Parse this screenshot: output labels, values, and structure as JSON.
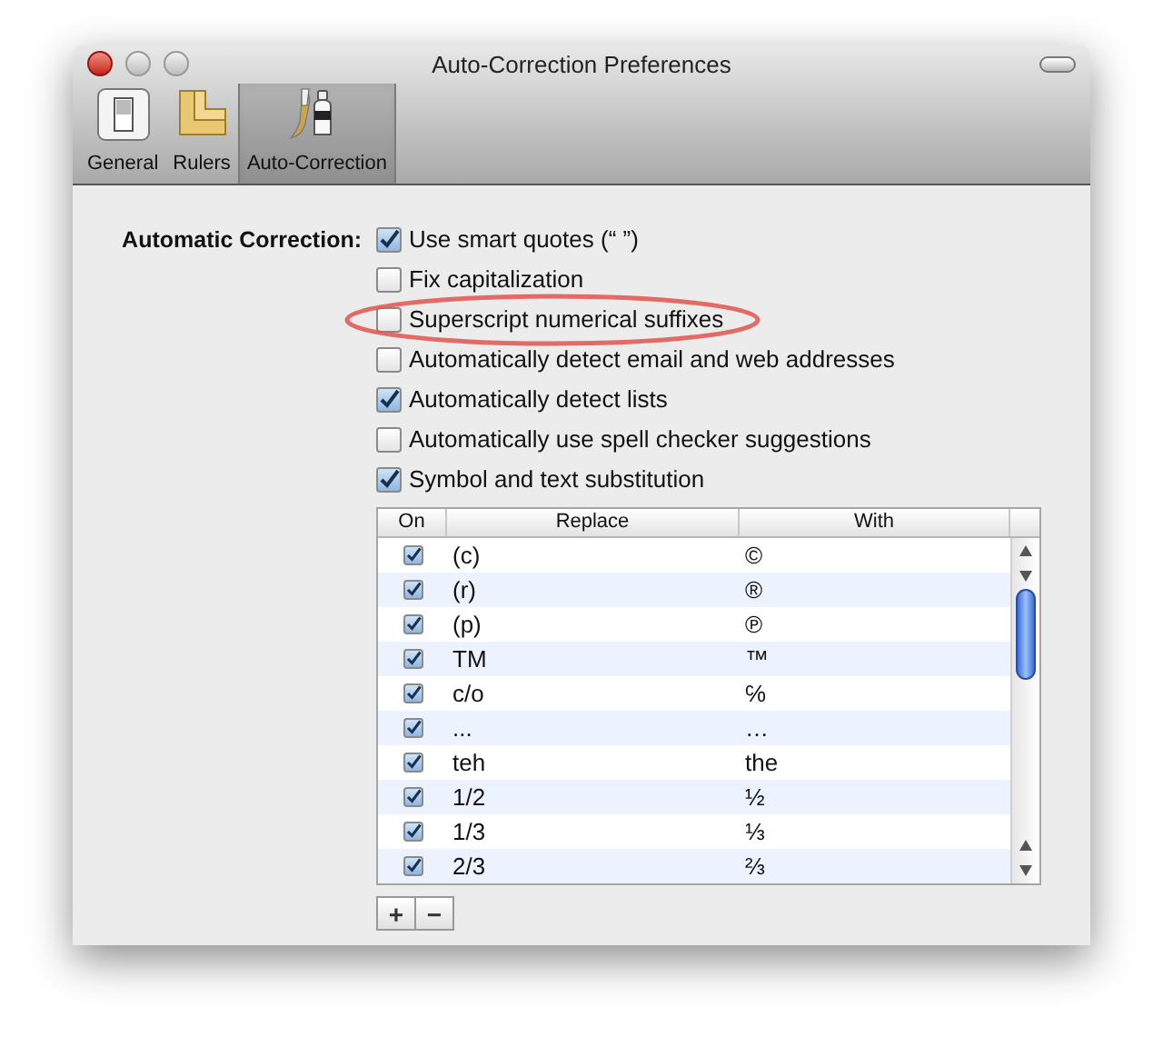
{
  "window": {
    "title": "Auto-Correction Preferences"
  },
  "toolbar": [
    {
      "label": "General",
      "kind": "general",
      "selected": false
    },
    {
      "label": "Rulers",
      "kind": "rulers",
      "selected": false
    },
    {
      "label": "Auto-Correction",
      "kind": "autocorrect",
      "selected": true
    }
  ],
  "section_label": "Automatic Correction:",
  "options": [
    {
      "label": "Use smart quotes (“ ”)",
      "checked": true,
      "highlighted": false
    },
    {
      "label": "Fix capitalization",
      "checked": false,
      "highlighted": false
    },
    {
      "label": "Superscript numerical suffixes",
      "checked": false,
      "highlighted": true
    },
    {
      "label": "Automatically detect email and web addresses",
      "checked": false,
      "highlighted": false
    },
    {
      "label": "Automatically detect lists",
      "checked": true,
      "highlighted": false
    },
    {
      "label": "Automatically use spell checker suggestions",
      "checked": false,
      "highlighted": false
    },
    {
      "label": "Symbol and text substitution",
      "checked": true,
      "highlighted": false
    }
  ],
  "table": {
    "columns": [
      "On",
      "Replace",
      "With"
    ],
    "rows": [
      {
        "on": true,
        "replace": "(c)",
        "with": "©"
      },
      {
        "on": true,
        "replace": "(r)",
        "with": "®"
      },
      {
        "on": true,
        "replace": "(p)",
        "with": "℗"
      },
      {
        "on": true,
        "replace": "TM",
        "with": "™"
      },
      {
        "on": true,
        "replace": "c/o",
        "with": "℅"
      },
      {
        "on": true,
        "replace": "...",
        "with": "…"
      },
      {
        "on": true,
        "replace": "teh",
        "with": "the"
      },
      {
        "on": true,
        "replace": "1/2",
        "with": "½"
      },
      {
        "on": true,
        "replace": "1/3",
        "with": "⅓"
      },
      {
        "on": true,
        "replace": "2/3",
        "with": "⅔"
      }
    ]
  },
  "buttons": [
    "+",
    "−"
  ]
}
